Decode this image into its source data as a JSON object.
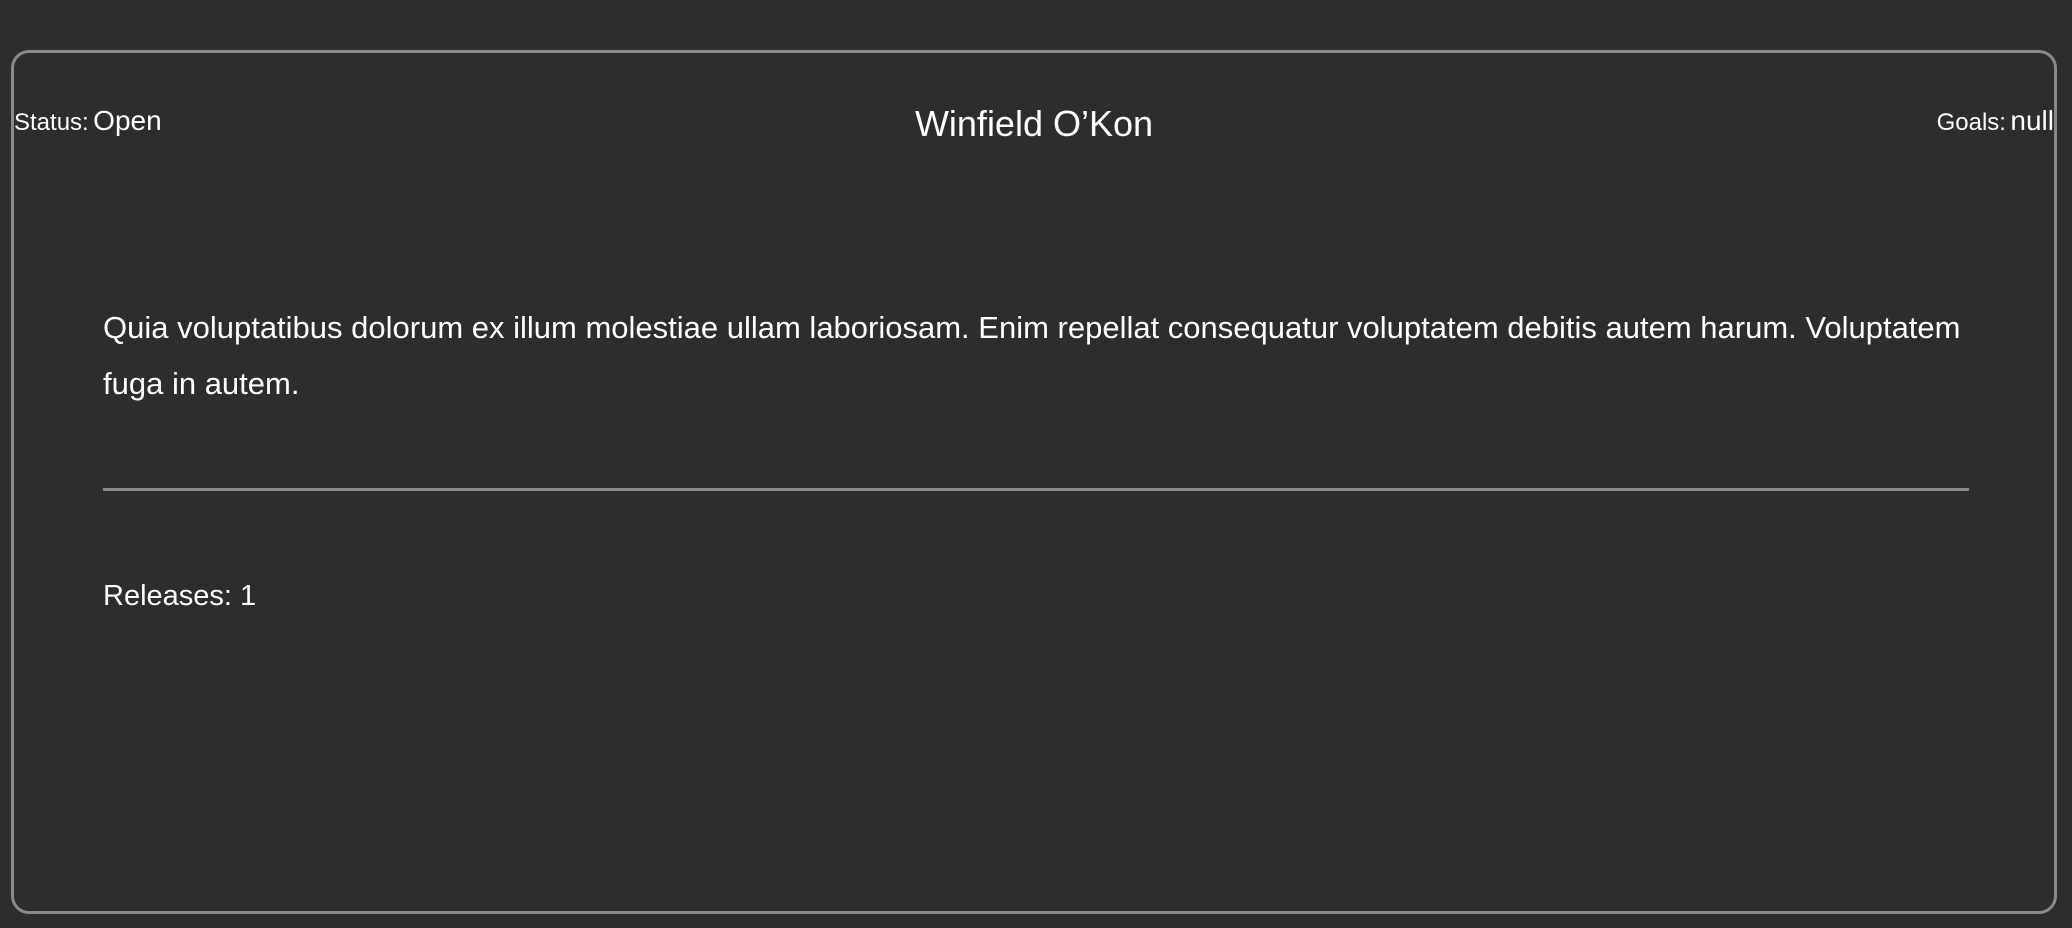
{
  "card": {
    "status": {
      "label": "Status:",
      "value": "Open"
    },
    "title": "Winfield O’Kon",
    "goals": {
      "label": "Goals:",
      "value": "null"
    },
    "description": "Quia voluptatibus dolorum ex illum molestiae ullam laboriosam. Enim repellat consequatur voluptatem debitis autem harum. Voluptatem fuga in autem.",
    "releases": {
      "label": "Releases:",
      "value": "1"
    }
  },
  "colors": {
    "background": "#2d2d2d",
    "border": "#8a8a8a",
    "text": "#ffffff"
  }
}
